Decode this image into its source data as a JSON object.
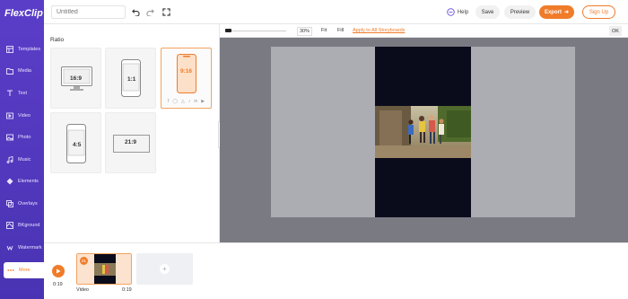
{
  "app": {
    "logo_text": "FlexClip",
    "brand_color": "#f07c2a",
    "sidebar_color": "#5b3ec8"
  },
  "header": {
    "title_placeholder": "Untitled",
    "undo_icon": "undo-icon",
    "redo_icon": "redo-icon",
    "fullscreen_icon": "fullscreen-icon",
    "help_label": "Help",
    "save_label": "Save",
    "preview_label": "Preview",
    "export_label": "Export",
    "signup_label": "Sign Up"
  },
  "sidebar": {
    "items": [
      {
        "label": "Templates",
        "icon": "templates-icon"
      },
      {
        "label": "Media",
        "icon": "media-icon"
      },
      {
        "label": "Text",
        "icon": "text-icon"
      },
      {
        "label": "Video",
        "icon": "video-icon"
      },
      {
        "label": "Photo",
        "icon": "photo-icon"
      },
      {
        "label": "Music",
        "icon": "music-icon"
      },
      {
        "label": "Elements",
        "icon": "elements-icon"
      },
      {
        "label": "Overlays",
        "icon": "overlays-icon"
      },
      {
        "label": "BKground",
        "icon": "background-icon"
      },
      {
        "label": "Watermark",
        "icon": "watermark-icon"
      },
      {
        "label": "More",
        "icon": "more-icon",
        "active": true
      }
    ]
  },
  "ratio_panel": {
    "title": "Ratio",
    "options": [
      "16:9",
      "1:1",
      "9:16",
      "4:5",
      "21:9"
    ],
    "selected": "9:16"
  },
  "canvas_toolbar": {
    "zoom": "30%",
    "fit_label": "Fit",
    "fill_label": "Fill",
    "apply_label": "Apply to All Storyboards",
    "ok_label": "OK"
  },
  "timeline": {
    "current_time": "0:19",
    "clip_number": "01",
    "clip_name": "Video",
    "clip_duration": "0:19"
  }
}
